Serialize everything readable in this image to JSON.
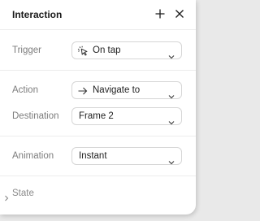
{
  "panel": {
    "title": "Interaction",
    "add_icon": "plus-icon",
    "close_icon": "close-icon"
  },
  "trigger": {
    "label": "Trigger",
    "value": "On tap",
    "icon": "tap-icon"
  },
  "action": {
    "label": "Action",
    "value": "Navigate to",
    "icon": "arrow-right-icon"
  },
  "destination": {
    "label": "Destination",
    "value": "Frame 2"
  },
  "animation": {
    "label": "Animation",
    "value": "Instant"
  },
  "state": {
    "label": "State",
    "icon": "chevron-right-icon"
  },
  "colors": {
    "border": "#d6d6d6",
    "label": "#7d7d7d",
    "text": "#1f1f1f"
  }
}
